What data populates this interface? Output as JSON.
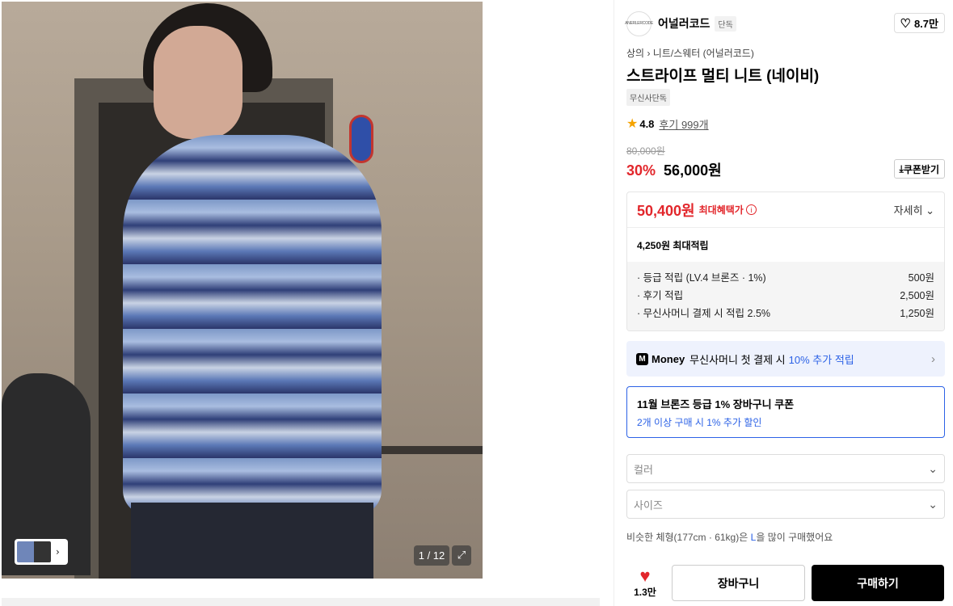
{
  "gallery": {
    "counter": "1 / 12"
  },
  "brand": {
    "name": "어널러코드",
    "badge": "단독",
    "logo_text": "ANERLERCODE",
    "likes": "8.7만"
  },
  "breadcrumb": {
    "cat1": "상의",
    "cat2": "니트/스웨터 (어널러코드)"
  },
  "product": {
    "title": "스트라이프 멀티 니트 (네이비)",
    "tag": "무신사단독"
  },
  "rating": {
    "score": "4.8",
    "reviews": "후기 999개"
  },
  "price": {
    "original": "80,000원",
    "discount": "30%",
    "sale": "56,000원",
    "coupon_label": "쿠폰받기"
  },
  "benefit": {
    "max_price": "50,400원",
    "max_label": "최대혜택가",
    "detail_label": "자세히",
    "points_total": "4,250원 최대적립",
    "rows": [
      {
        "label": "· 등급 적립 (LV.4 브론즈 · 1%)",
        "value": "500원"
      },
      {
        "label": "· 후기 적립",
        "value": "2,500원"
      },
      {
        "label": "· 무신사머니 결제 시 적립 2.5%",
        "value": "1,250원"
      }
    ]
  },
  "money": {
    "logo": "M",
    "brand": "Money",
    "text": "무신사머니 첫 결제 시",
    "highlight": "10% 추가 적립"
  },
  "coupon_box": {
    "title": "11월 브론즈 등급 1% 장바구니 쿠폰",
    "sub": "2개 이상 구매 시 1% 추가 할인"
  },
  "options": {
    "color": "컬러",
    "size": "사이즈"
  },
  "similar": {
    "pre": "비슷한 체형(177cm · 61kg)은",
    "size": "L",
    "post": "을 많이 구매했어요"
  },
  "actions": {
    "likes": "1.3만",
    "cart": "장바구니",
    "buy": "구매하기"
  },
  "colors": {
    "accent_red": "#e2262b",
    "accent_blue": "#2c62e6",
    "buy_bg": "#000000"
  }
}
